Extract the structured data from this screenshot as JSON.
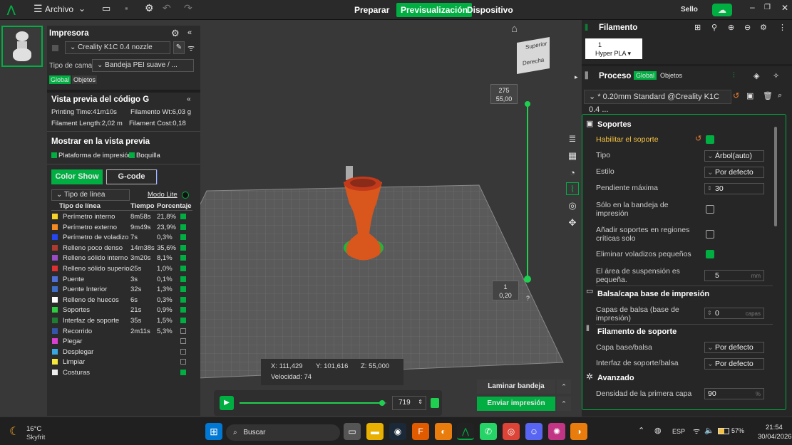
{
  "topbar": {
    "menu_label": "Archivo",
    "tabs": [
      {
        "label": "Preparar"
      },
      {
        "label": "Previsualización"
      },
      {
        "label": "Dispositivo"
      }
    ],
    "seal": "Sello"
  },
  "printer": {
    "title": "Impresora",
    "name": "Creality K1C 0.4 nozzle",
    "bed_label": "Tipo de cama",
    "bed_value": "Bandeja PEI suave / ...",
    "tab_global": "Global",
    "tab_objects": "Objetos"
  },
  "gcode_preview": {
    "title": "Vista previa del código G",
    "print_time": "Printing Time:41m10s",
    "filament_wt": "Filamento Wt:6,03 g",
    "filament_length": "Filament Length:2,02 m",
    "filament_cost": "Filament Cost:0,18",
    "show_title": "Mostrar en la vista previa",
    "show_platform": "Plataforma de impresión",
    "show_nozzle": "Boquilla",
    "btn_color_show": "Color Show",
    "btn_gcode": "G-code",
    "line_type_select": "Tipo de línea",
    "lite_mode": "Modo Lite",
    "headers": {
      "type": "Tipo de línea",
      "time": "Tiempo",
      "percent": "Porcentaje"
    },
    "rows": [
      {
        "name": "Perímetro interno",
        "time": "8m58s",
        "pct": "21,8%",
        "color": "#f5d327",
        "checked": true
      },
      {
        "name": "Perímetro externo",
        "time": "9m49s",
        "pct": "23,9%",
        "color": "#f58a22",
        "checked": true
      },
      {
        "name": "Perímetro de voladizo",
        "time": "7s",
        "pct": "0,3%",
        "color": "#2546f0",
        "checked": true
      },
      {
        "name": "Relleno poco denso",
        "time": "14m38s",
        "pct": "35,6%",
        "color": "#b03a2e",
        "checked": true
      },
      {
        "name": "Relleno sólido interno",
        "time": "3m20s",
        "pct": "8,1%",
        "color": "#9a4cc7",
        "checked": true
      },
      {
        "name": "Relleno sólido superior",
        "time": "25s",
        "pct": "1,0%",
        "color": "#e03030",
        "checked": true
      },
      {
        "name": "Puente",
        "time": "3s",
        "pct": "0,1%",
        "color": "#4d6fd6",
        "checked": true
      },
      {
        "name": "Puente Interior",
        "time": "32s",
        "pct": "1,3%",
        "color": "#3f6ec9",
        "checked": true
      },
      {
        "name": "Relleno de huecos",
        "time": "6s",
        "pct": "0,3%",
        "color": "#ffffff",
        "checked": true
      },
      {
        "name": "Soportes",
        "time": "21s",
        "pct": "0,9%",
        "color": "#2ecc40",
        "checked": true
      },
      {
        "name": "Interfaz de soporte",
        "time": "35s",
        "pct": "1,5%",
        "color": "#1e7d32",
        "checked": true
      },
      {
        "name": "Recorrido",
        "time": "2m11s",
        "pct": "5,3%",
        "color": "#3355aa",
        "checked": false
      },
      {
        "name": "Plegar",
        "time": "",
        "pct": "",
        "color": "#d940d0",
        "checked": false
      },
      {
        "name": "Desplegar",
        "time": "",
        "pct": "",
        "color": "#3aa6e0",
        "checked": false
      },
      {
        "name": "Limpiar",
        "time": "",
        "pct": "",
        "color": "#f5e63a",
        "checked": false
      },
      {
        "name": "Costuras",
        "time": "",
        "pct": "",
        "color": "#eeeeee",
        "checked": true
      }
    ]
  },
  "viewport": {
    "layer_top_a": "275",
    "layer_top_b": "55,00",
    "layer_bottom_a": "1",
    "layer_bottom_b": "0,20",
    "help": "?",
    "coord_x": "X: 111,429",
    "coord_y": "Y: 101,616",
    "coord_z": "Z: 55,000",
    "speed": "Velocidad: 74",
    "layer_value": "719",
    "cube_top": "Superior",
    "cube_right": "Derecha",
    "slice_btn": "Laminar bandeja",
    "send_btn": "Enviar impresión",
    "slider_progress": 0.97,
    "layer_slider_level": 1.0
  },
  "filament": {
    "title": "Filamento",
    "slot_number": "1",
    "slot_name": "Hyper PLA ▾"
  },
  "process": {
    "title": "Proceso",
    "tab_global": "Global",
    "tab_objects": "Objetos",
    "preset": "* 0.20mm Standard @Creality K1C 0.4 ...",
    "sec_supports": "Soportes",
    "enable_support": "Habilitar el soporte",
    "type_label": "Tipo",
    "type_value": "Árbol(auto)",
    "style_label": "Estilo",
    "style_value": "Por defecto",
    "max_slope_label": "Pendiente máxima",
    "max_slope_value": "30",
    "only_bed_label": "Sólo en la bandeja de impresión",
    "critical_label": "Añadir soportes en regiones críticas solo",
    "remove_small_label": "Eliminar voladizos pequeños",
    "susp_area_label": "El área de suspensión es pequeña.",
    "susp_area_value": "5",
    "unit_mm": "mm",
    "sec_raft": "Balsa/capa base de impresión",
    "raft_layers_label": "Capas de balsa (base de impresión)",
    "raft_layers_value": "0",
    "unit_layers": "capas",
    "sec_filament": "Filamento de soporte",
    "base_layer_label": "Capa base/balsa",
    "base_layer_value": "Por defecto",
    "interface_label": "Interfaz de soporte/balsa",
    "interface_value": "Por defecto",
    "sec_advanced": "Avanzado",
    "first_layer_label": "Densidad de la primera capa",
    "first_layer_value": "90",
    "unit_pct": "%"
  },
  "taskbar": {
    "temp": "16°C",
    "weather": "Skyfrit",
    "search": "Buscar",
    "lang": "ESP",
    "battery": "57%",
    "time": "21:54",
    "date": "30/04/2026"
  },
  "colors": {
    "accent": "#00ae42"
  }
}
